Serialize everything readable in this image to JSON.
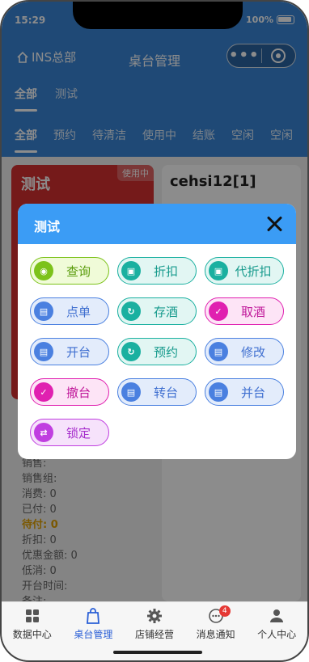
{
  "status": {
    "time": "15:29",
    "battery": "100%"
  },
  "nav": {
    "home_label": "INS总部",
    "title": "桌台管理"
  },
  "tabs_primary": [
    "全部",
    "测试"
  ],
  "tabs_secondary": [
    "全部",
    "预约",
    "待清洁",
    "使用中",
    "结账",
    "空闲",
    "空闲"
  ],
  "tables": {
    "left": {
      "name": "测试",
      "badge": "使用中"
    },
    "right": {
      "name": "cehsi12[1]"
    }
  },
  "info": {
    "sales": "销售:",
    "sales_group": "销售组:",
    "consume": "消费: 0",
    "paid": "已付: 0",
    "pending": "待付: 0",
    "discount": "折扣: 0",
    "promo": "优惠金额: 0",
    "min": "低消: 0",
    "open_time": "开台时间:",
    "remark": "备注:"
  },
  "modal": {
    "title": "测试",
    "actions": [
      {
        "label": "查询",
        "color": "green",
        "icon": "search-icon"
      },
      {
        "label": "折扣",
        "color": "teal",
        "icon": "discount-icon"
      },
      {
        "label": "代折扣",
        "color": "teal",
        "icon": "discount-icon"
      },
      {
        "label": "点单",
        "color": "blue",
        "icon": "order-icon"
      },
      {
        "label": "存酒",
        "color": "teal",
        "icon": "refresh-icon"
      },
      {
        "label": "取酒",
        "color": "pink",
        "icon": "check-icon"
      },
      {
        "label": "开台",
        "color": "blue",
        "icon": "open-table-icon"
      },
      {
        "label": "预约",
        "color": "teal",
        "icon": "refresh-icon"
      },
      {
        "label": "修改",
        "color": "blue",
        "icon": "edit-icon"
      },
      {
        "label": "撤台",
        "color": "pink",
        "icon": "check-icon"
      },
      {
        "label": "转台",
        "color": "blue",
        "icon": "transfer-icon"
      },
      {
        "label": "并台",
        "color": "blue",
        "icon": "merge-icon"
      },
      {
        "label": "锁定",
        "color": "purple",
        "icon": "lock-icon"
      }
    ]
  },
  "tabbar": {
    "items": [
      {
        "label": "数据中心",
        "icon": "grid-icon"
      },
      {
        "label": "桌台管理",
        "icon": "bag-icon"
      },
      {
        "label": "店铺经营",
        "icon": "gear-icon"
      },
      {
        "label": "消息通知",
        "icon": "message-icon",
        "badge": "4"
      },
      {
        "label": "个人中心",
        "icon": "person-icon"
      }
    ]
  }
}
